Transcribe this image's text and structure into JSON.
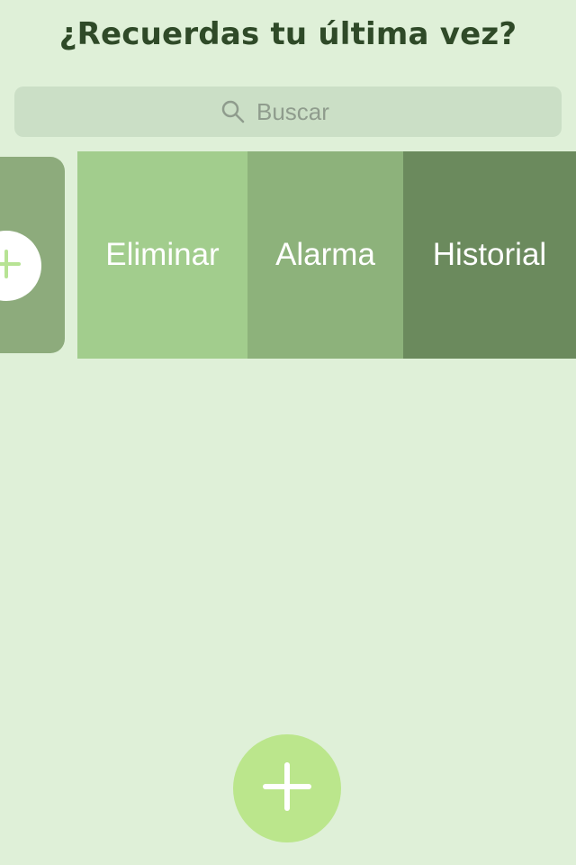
{
  "header": {
    "title": "¿Recuerdas tu última vez?"
  },
  "search": {
    "placeholder": "Buscar",
    "value": ""
  },
  "row": {
    "actions": [
      {
        "label": "Eliminar"
      },
      {
        "label": "Alarma"
      },
      {
        "label": "Historial"
      }
    ]
  },
  "icons": {
    "search": "search-icon",
    "card_add": "plus-icon",
    "fab": "plus-icon"
  },
  "colors": {
    "background": "#dff0d8",
    "title": "#2f4a28",
    "search_bg": "#cbdfc6",
    "card_bg": "#8dab7c",
    "eliminar_bg": "#a2cd8d",
    "alarma_bg": "#8db27b",
    "historial_bg": "#6b8a5d",
    "fab_bg": "#bbe68c",
    "plus_green": "#b7e394"
  }
}
